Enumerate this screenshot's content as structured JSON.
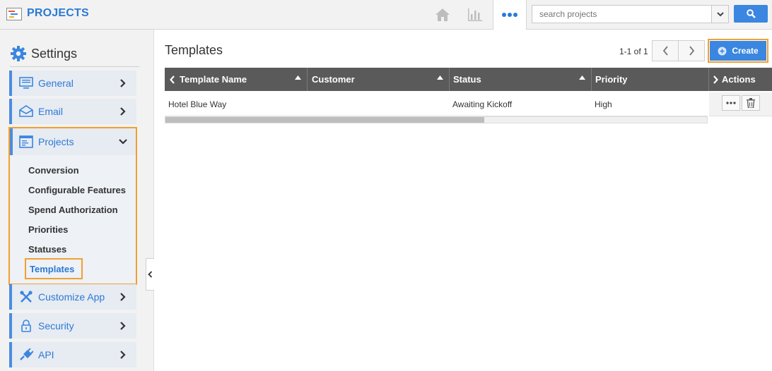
{
  "app": {
    "title": "PROJECTS"
  },
  "topbar": {
    "icons": [
      "home-icon",
      "bar-chart-icon",
      "more-icon"
    ],
    "search": {
      "placeholder": "search projects",
      "value": ""
    },
    "colors": {
      "accent": "#2b7ad6",
      "button": "#3a86e0"
    }
  },
  "sidebar": {
    "heading": "Settings",
    "items": [
      {
        "label": "General",
        "icon": "monitor-icon"
      },
      {
        "label": "Email",
        "icon": "envelope-icon"
      },
      {
        "label": "Projects",
        "icon": "projects-icon",
        "expanded": true
      },
      {
        "label": "Customize App",
        "icon": "tools-icon"
      },
      {
        "label": "Security",
        "icon": "lock-icon"
      },
      {
        "label": "API",
        "icon": "plug-icon"
      }
    ],
    "projects_sub": [
      "Conversion",
      "Configurable Features",
      "Spend Authorization",
      "Priorities",
      "Statuses",
      "Templates"
    ],
    "active_sub": "Templates",
    "highlight_color": "#f0a030"
  },
  "main": {
    "title": "Templates",
    "pager": {
      "text": "1-1 of 1"
    },
    "create_label": "Create",
    "table": {
      "columns": [
        "Template Name",
        "Customer",
        "Status",
        "Priority",
        "Actions"
      ],
      "rows": [
        {
          "template_name": "Hotel Blue Way",
          "customer": "",
          "status": "Awaiting Kickoff",
          "priority": "High"
        }
      ]
    }
  }
}
